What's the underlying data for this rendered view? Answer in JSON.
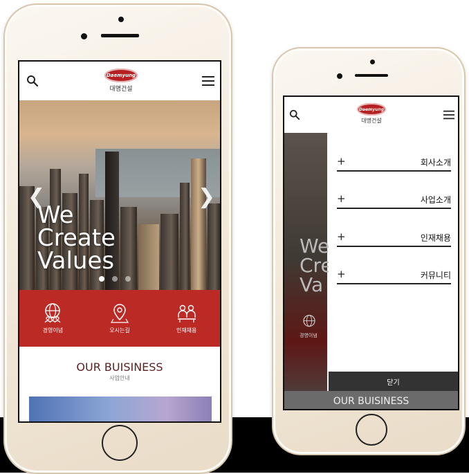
{
  "brand": {
    "logo_word": "Daemyung",
    "name": "대명건설"
  },
  "left_phone": {
    "hero": {
      "title_lines": [
        "We",
        "Create",
        "Values"
      ],
      "prev": "❮",
      "next": "❯",
      "slides": 3,
      "active_slide": 0
    },
    "quick_menu": [
      {
        "label": "경영이념",
        "icon": "globe-people-icon"
      },
      {
        "label": "오시는길",
        "icon": "map-pin-icon"
      },
      {
        "label": "인재채용",
        "icon": "people-icon"
      }
    ],
    "business": {
      "title": "OUR BUISINESS",
      "subtitle": "사업안내"
    }
  },
  "right_phone": {
    "menu": [
      {
        "plus": "+",
        "label": "회사소개"
      },
      {
        "plus": "+",
        "label": "사업소개"
      },
      {
        "plus": "+",
        "label": "인재채용"
      },
      {
        "plus": "+",
        "label": "커뮤니티"
      }
    ],
    "close_label": "닫기",
    "background_text": "We\nCre\nVa",
    "behind_label": "경영이념",
    "business_title": "OUR BUISINESS"
  },
  "colors": {
    "brand_red": "#bc2a26",
    "dark_bar": "#333333"
  }
}
